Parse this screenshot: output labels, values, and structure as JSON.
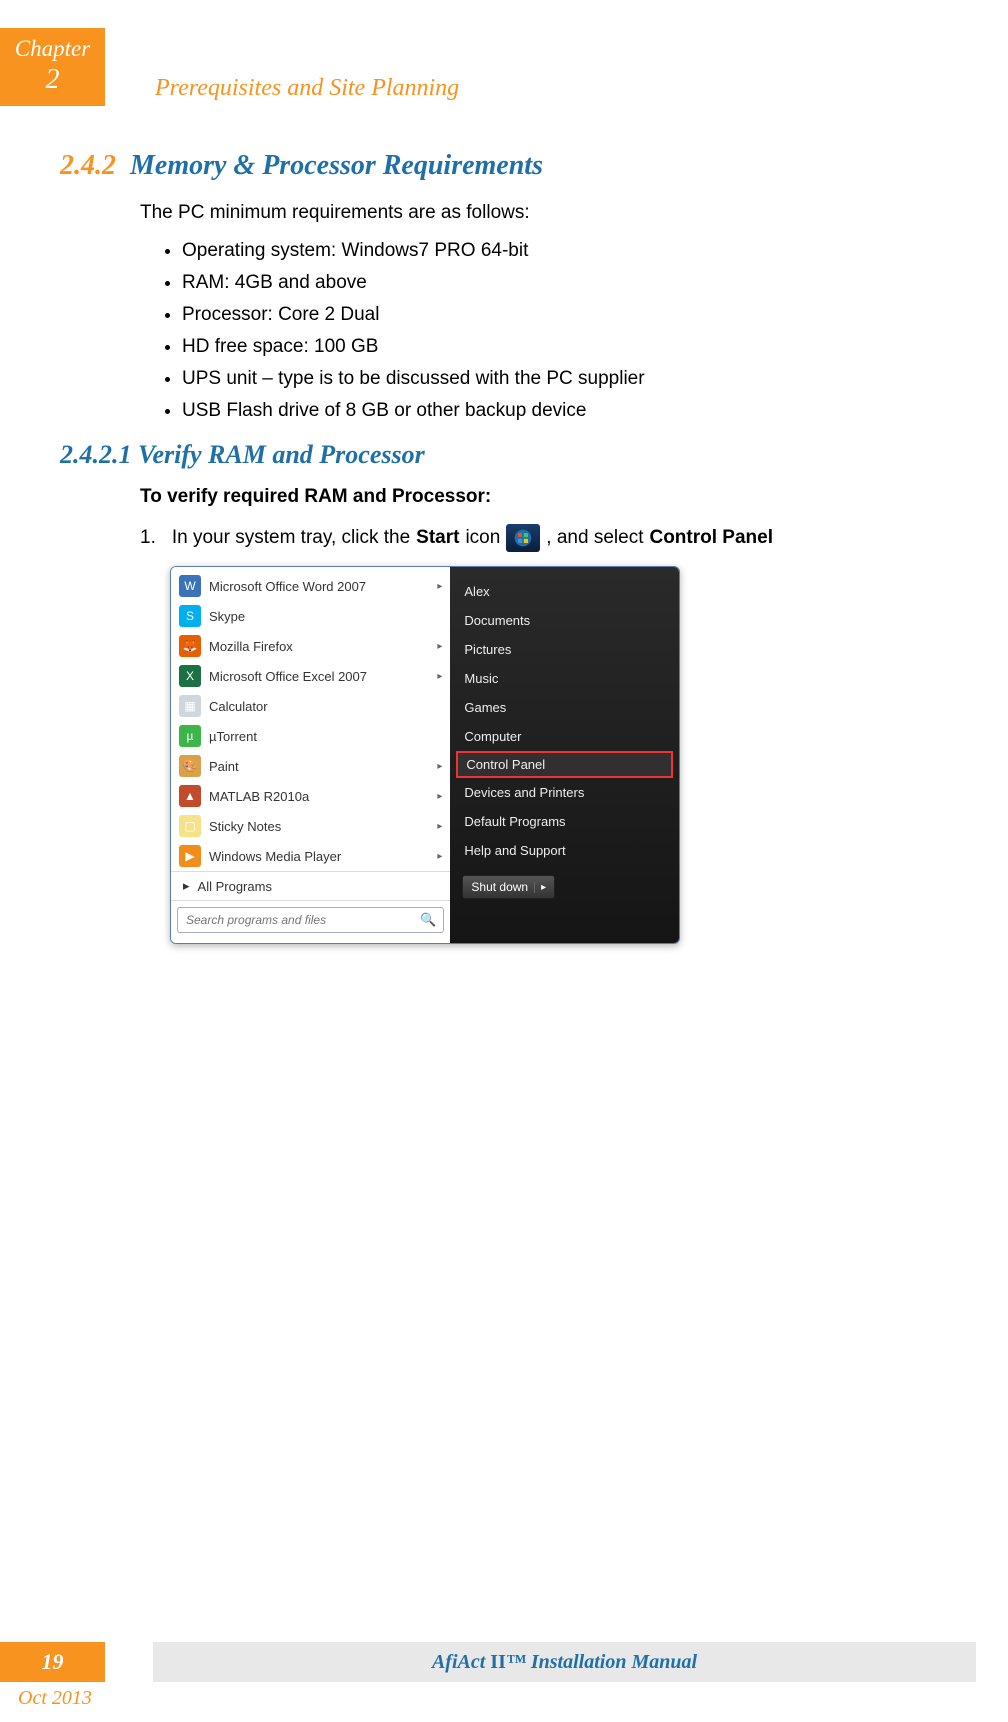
{
  "header": {
    "chapter_label": "Chapter",
    "chapter_number": "2",
    "chapter_title": "Prerequisites and Site Planning"
  },
  "section": {
    "number": "2.4.2",
    "title": "Memory & Processor Requirements",
    "intro": "The PC minimum requirements are as follows:",
    "bullets": [
      "Operating system: Windows7 PRO 64-bit",
      "RAM: 4GB and above",
      "Processor: Core 2 Dual",
      "HD free space: 100 GB",
      "UPS unit – type is to be discussed with the PC supplier",
      "USB Flash drive of 8 GB or other backup device"
    ]
  },
  "subsection": {
    "number": "2.4.2.1",
    "title": "Verify RAM and Processor",
    "lead": "To verify required RAM and Processor:",
    "step_num": "1.",
    "step_a": "In your system tray, click the ",
    "step_b": "Start",
    "step_c": " icon ",
    "step_d": ", and select ",
    "step_e": "Control Panel"
  },
  "start_menu": {
    "left_items": [
      {
        "label": "Microsoft Office Word 2007",
        "color": "#3b73b9",
        "glyph": "W",
        "arrow": true
      },
      {
        "label": "Skype",
        "color": "#00aff0",
        "glyph": "S",
        "arrow": false
      },
      {
        "label": "Mozilla Firefox",
        "color": "#e66000",
        "glyph": "🦊",
        "arrow": true
      },
      {
        "label": "Microsoft Office Excel 2007",
        "color": "#1d7044",
        "glyph": "X",
        "arrow": true
      },
      {
        "label": "Calculator",
        "color": "#cfd6dd",
        "glyph": "▦",
        "arrow": false
      },
      {
        "label": "µTorrent",
        "color": "#3eb54a",
        "glyph": "µ",
        "arrow": false
      },
      {
        "label": "Paint",
        "color": "#d8a24a",
        "glyph": "🎨",
        "arrow": true
      },
      {
        "label": "MATLAB R2010a",
        "color": "#c14b2a",
        "glyph": "▲",
        "arrow": true
      },
      {
        "label": "Sticky Notes",
        "color": "#f5e38b",
        "glyph": "▢",
        "arrow": true
      },
      {
        "label": "Windows Media Player",
        "color": "#f28c1a",
        "glyph": "▶",
        "arrow": true
      }
    ],
    "all_programs": "All Programs",
    "search_placeholder": "Search programs and files",
    "right_items": [
      {
        "label": "Alex",
        "highlight": false
      },
      {
        "label": "Documents",
        "highlight": false
      },
      {
        "label": "Pictures",
        "highlight": false
      },
      {
        "label": "Music",
        "highlight": false
      },
      {
        "label": "Games",
        "highlight": false
      },
      {
        "label": "Computer",
        "highlight": false
      },
      {
        "label": "Control Panel",
        "highlight": true
      },
      {
        "label": "Devices and Printers",
        "highlight": false
      },
      {
        "label": "Default Programs",
        "highlight": false
      },
      {
        "label": "Help and Support",
        "highlight": false
      }
    ],
    "shutdown": "Shut down"
  },
  "footer": {
    "page": "19",
    "title_a": "AfiAct ",
    "title_b": "II",
    "title_c": "™ Installation Manual",
    "date": "Oct 2013"
  }
}
